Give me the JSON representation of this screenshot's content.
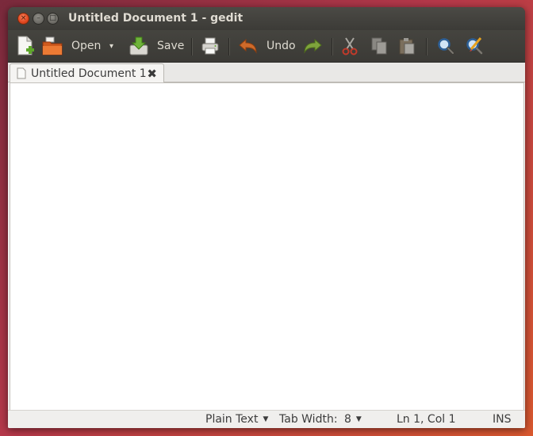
{
  "window": {
    "title": "Untitled Document 1 - gedit",
    "controls": {
      "close": "×",
      "minimize": "–",
      "maximize": "□"
    }
  },
  "toolbar": {
    "open_label": "Open",
    "open_menu_arrow": "▾",
    "save_label": "Save",
    "undo_label": "Undo",
    "icons": [
      "new-document-icon",
      "open-folder-icon",
      "save-icon",
      "print-icon",
      "undo-icon",
      "redo-icon",
      "cut-icon",
      "copy-icon",
      "paste-icon",
      "find-icon",
      "find-replace-icon"
    ]
  },
  "tabs": [
    {
      "label": "Untitled Document 1",
      "close": "✖"
    }
  ],
  "editor": {
    "text": ""
  },
  "statusbar": {
    "language": "Plain Text",
    "tab_width_label": "Tab Width:",
    "tab_width_value": "8",
    "dropdown_arrow": "▼",
    "cursor_position": "Ln 1, Col 1",
    "insert_mode": "INS"
  },
  "colors": {
    "titlebar": "#3c3b37",
    "close_button": "#e1461f",
    "editor_background": "#ffffff",
    "desktop": "#b5384a"
  }
}
